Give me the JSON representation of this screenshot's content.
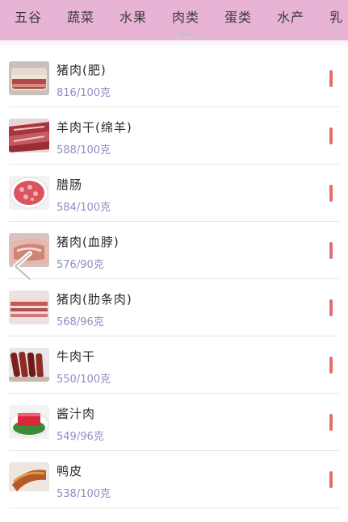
{
  "tabs": [
    {
      "label": "五谷",
      "active": false
    },
    {
      "label": "蔬菜",
      "active": false
    },
    {
      "label": "水果",
      "active": false
    },
    {
      "label": "肉类",
      "active": true
    },
    {
      "label": "蛋类",
      "active": false
    },
    {
      "label": "水产",
      "active": false
    },
    {
      "label": "乳",
      "active": false
    }
  ],
  "colors": {
    "tabbar_bg": "#e8b4d6",
    "calorie_text": "#8e8cc4",
    "marker": "#e07070"
  },
  "foods": [
    {
      "name": "猪肉(肥)",
      "calories": "816/100克",
      "thumb_icon": "fatty-pork-photo"
    },
    {
      "name": "羊肉干(绵羊)",
      "calories": "588/100克",
      "thumb_icon": "dried-mutton-photo"
    },
    {
      "name": "腊肠",
      "calories": "584/100克",
      "thumb_icon": "chinese-sausage-photo"
    },
    {
      "name": "猪肉(血脖)",
      "calories": "576/90克",
      "thumb_icon": "pork-neck-photo"
    },
    {
      "name": "猪肉(肋条肉)",
      "calories": "568/96克",
      "thumb_icon": "pork-belly-photo"
    },
    {
      "name": "牛肉干",
      "calories": "550/100克",
      "thumb_icon": "beef-jerky-photo"
    },
    {
      "name": "酱汁肉",
      "calories": "549/96克",
      "thumb_icon": "sauced-pork-photo"
    },
    {
      "name": "鸭皮",
      "calories": "538/100克",
      "thumb_icon": "duck-skin-photo"
    }
  ],
  "overlay": {
    "back_icon": "chevron-left-icon"
  }
}
